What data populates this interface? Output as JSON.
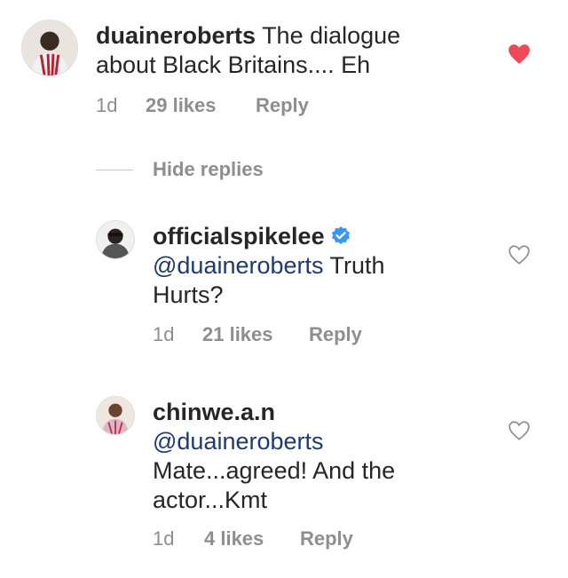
{
  "comments": [
    {
      "username": "duaineroberts",
      "text_line1": "The dialogue",
      "text_line2": "about Black Britains.... Eh",
      "time": "1d",
      "likes": "29 likes",
      "reply": "Reply",
      "liked": true,
      "verified": false
    }
  ],
  "replies_toggle": {
    "label": "Hide replies"
  },
  "replies": [
    {
      "username": "officialspikelee",
      "verified": true,
      "mention": "@duaineroberts",
      "text_line1": "Truth",
      "text_line2": "Hurts?",
      "time": "1d",
      "likes": "21 likes",
      "reply": "Reply",
      "liked": false
    },
    {
      "username": "chinwe.a.n",
      "verified": false,
      "mention": "@duaineroberts",
      "text_line1": "Mate...agreed! And the",
      "text_line2": "actor...Kmt",
      "time": "1d",
      "likes": "4 likes",
      "reply": "Reply",
      "liked": false
    }
  ],
  "colors": {
    "liked_heart": "#ed4956",
    "mention": "#1e3a6e",
    "meta_text": "#8e8e8e",
    "verified_badge": "#3897f0"
  },
  "icons": {
    "liked": "heart-filled-icon",
    "unliked": "heart-outline-icon",
    "verified": "verified-badge-icon"
  }
}
